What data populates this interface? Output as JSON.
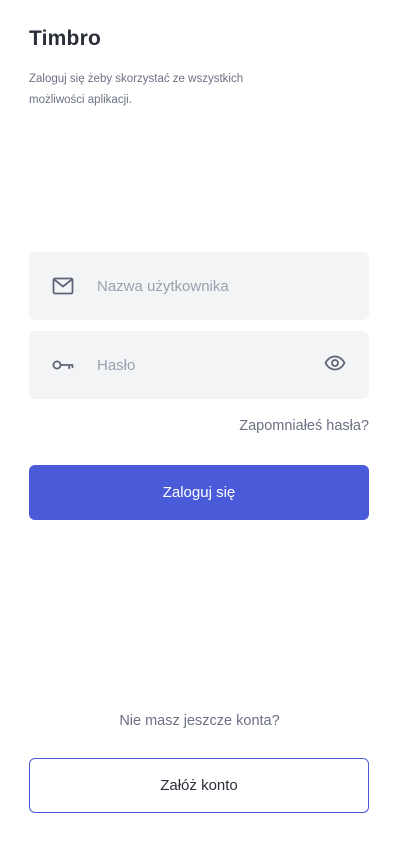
{
  "header": {
    "title": "Timbro",
    "subtitle": "Zaloguj się żeby skorzystać ze wszystkich możliwości aplikacji."
  },
  "login_form": {
    "username": {
      "placeholder": "Nazwa użytkownika",
      "value": "",
      "icon": "mail-icon"
    },
    "password": {
      "placeholder": "Hasło",
      "value": "",
      "icon": "key-icon",
      "toggle_icon": "eye-icon"
    },
    "forgot_password_label": "Zapomniałeś hasła?",
    "submit_label": "Zaloguj się"
  },
  "signup": {
    "prompt": "Nie masz jeszcze konta?",
    "button_label": "Załóż konto"
  },
  "colors": {
    "accent": "#4a5bd9",
    "field_bg": "#f3f4f6",
    "title_text": "#2b2f3a",
    "muted_text": "#6c7183",
    "placeholder_text": "#9aa0ae",
    "icon_color": "#5f6579"
  }
}
